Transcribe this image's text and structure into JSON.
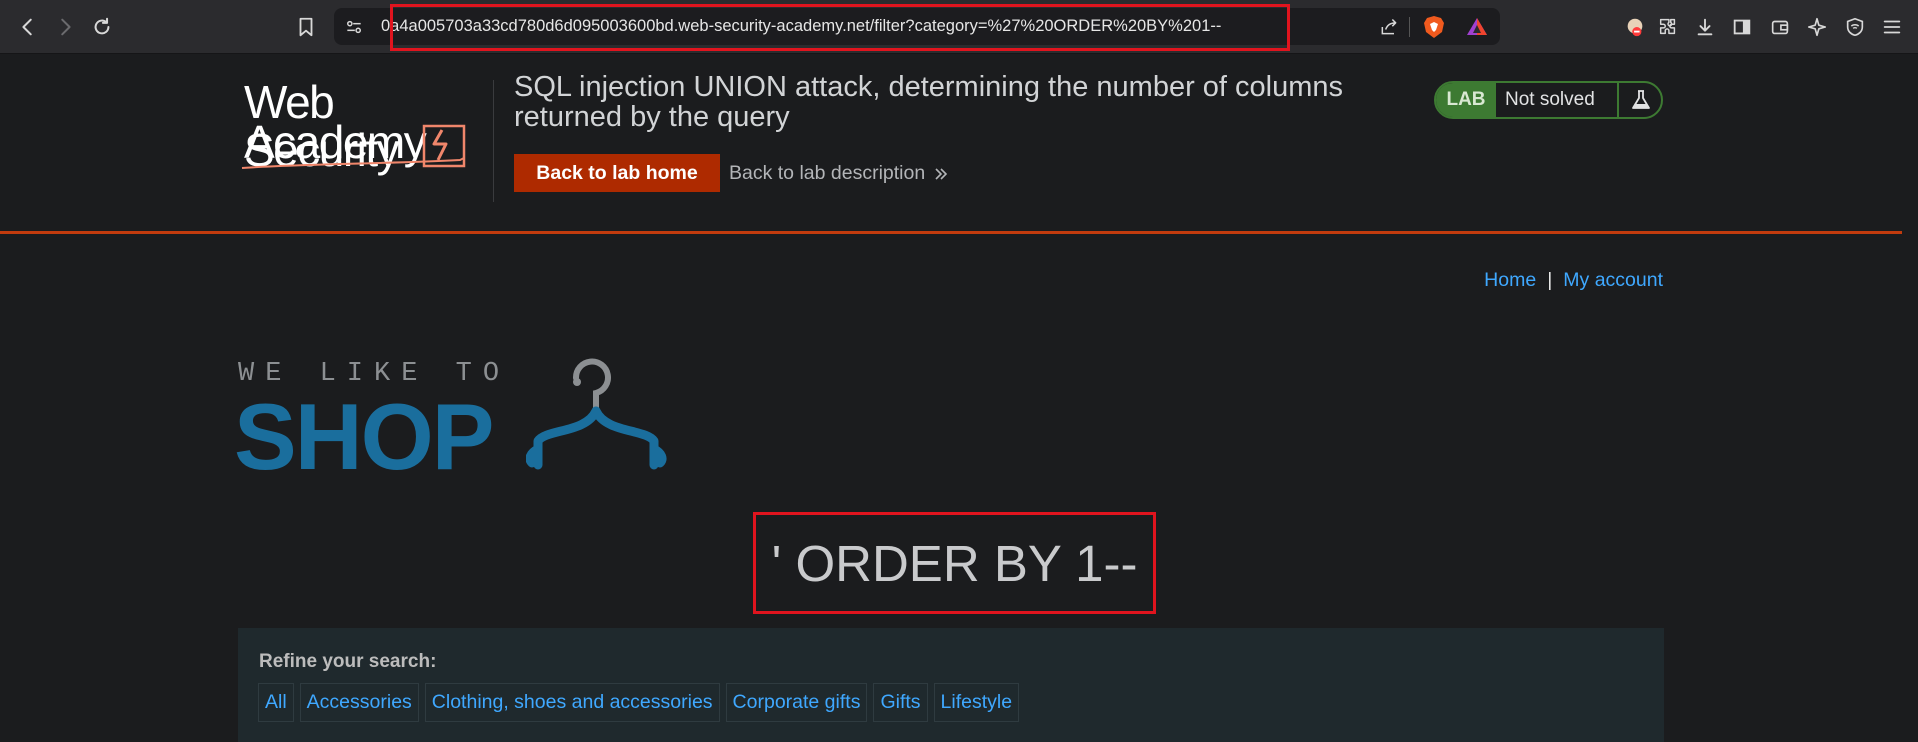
{
  "browser": {
    "url": "0a4a005703a33cd780d6d095003600bd.web-security-academy.net/filter?category=%27%20ORDER%20BY%201--"
  },
  "lab": {
    "logo_line1": "Web Security",
    "logo_line2": "Academy",
    "title": "SQL injection UNION attack, determining the number of columns returned by the query",
    "back_home_label": "Back to lab home",
    "back_description_label": "Back to lab description",
    "badge": "LAB",
    "status": "Not solved"
  },
  "nav": {
    "home": "Home",
    "separator": "|",
    "account": "My account"
  },
  "shop_logo": {
    "tagline": "WE LIKE TO",
    "word": "SHOP"
  },
  "filter": {
    "heading": "' ORDER BY 1--"
  },
  "refine": {
    "label": "Refine your search:",
    "categories": [
      "All",
      "Accessories",
      "Clothing, shoes and accessories",
      "Corporate gifts",
      "Gifts",
      "Lifestyle"
    ]
  },
  "colors": {
    "accent_orange": "#ae2a00",
    "lab_green": "#3d7a32",
    "link_blue": "#3fa8ff",
    "shop_blue": "#1a6e9d",
    "highlight_red": "#e0141e"
  }
}
